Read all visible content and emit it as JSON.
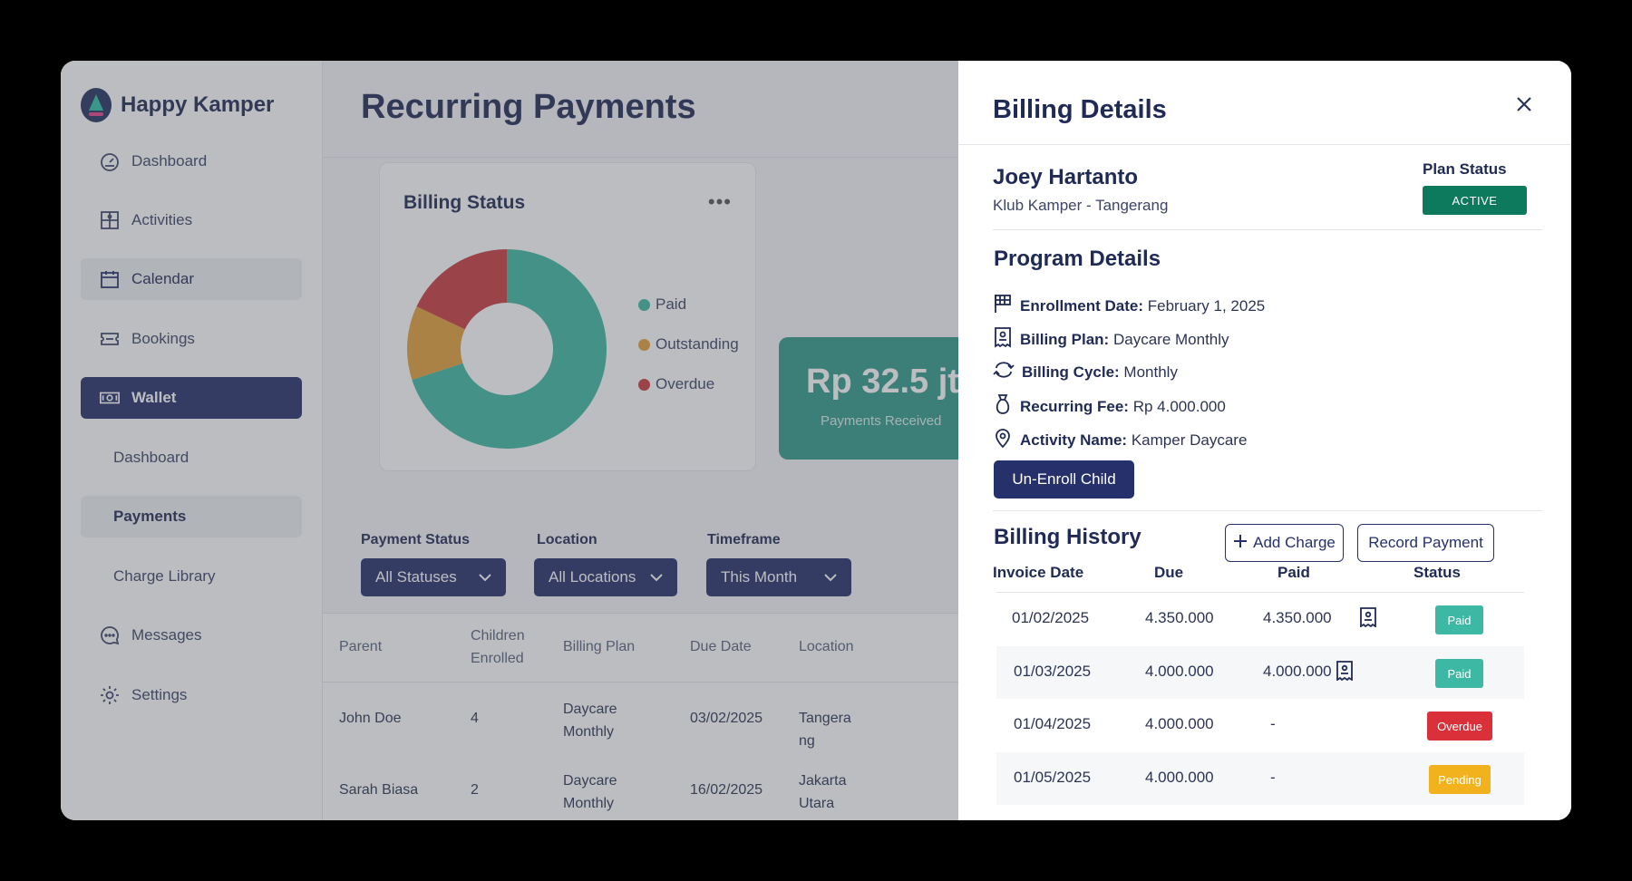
{
  "brand": {
    "name": "Happy Kamper"
  },
  "sidebar": {
    "items": [
      {
        "label": "Dashboard",
        "icon": "dashboard-gauge-icon"
      },
      {
        "label": "Activities",
        "icon": "activities-puzzle-icon"
      },
      {
        "label": "Calendar",
        "icon": "calendar-icon"
      },
      {
        "label": "Bookings",
        "icon": "ticket-icon"
      },
      {
        "label": "Wallet",
        "icon": "wallet-icon",
        "active": true
      },
      {
        "label": "Dashboard",
        "sub": true
      },
      {
        "label": "Payments",
        "sub": true,
        "active": true
      },
      {
        "label": "Charge Library",
        "sub": true
      },
      {
        "label": "Messages",
        "icon": "chat-bubble-icon"
      },
      {
        "label": "Settings",
        "icon": "gear-icon"
      }
    ]
  },
  "page": {
    "title": "Recurring Payments"
  },
  "billing_status": {
    "title": "Billing Status",
    "menu": "•••",
    "legend": [
      "Paid",
      "Outstanding",
      "Overdue"
    ]
  },
  "chart_data": {
    "type": "pie",
    "title": "Billing Status",
    "categories": [
      "Paid",
      "Outstanding",
      "Overdue"
    ],
    "values": [
      70,
      12,
      18
    ],
    "colors": [
      "#3cb8a4",
      "#e4a13a",
      "#c93a3f"
    ],
    "donut": true,
    "legend_position": "right"
  },
  "stat": {
    "value": "Rp 32.5 jt",
    "label": "Payments Received"
  },
  "filters": [
    {
      "label": "Payment Status",
      "value": "All Statuses"
    },
    {
      "label": "Location",
      "value": "All Locations"
    },
    {
      "label": "Timeframe",
      "value": "This Month"
    }
  ],
  "table": {
    "headers": [
      "Parent",
      "Children Enrolled",
      "Billing Plan",
      "Due Date",
      "Location"
    ],
    "rows": [
      {
        "parent": "John Doe",
        "children": "4",
        "plan": "Daycare Monthly",
        "due": "03/02/2025",
        "location": "Tangerang"
      },
      {
        "parent": "Sarah Biasa",
        "children": "2",
        "plan": "Daycare Monthly",
        "due": "16/02/2025",
        "location": "Jakarta Utara"
      }
    ]
  },
  "drawer": {
    "title": "Billing Details",
    "person": {
      "name": "Joey Hartanto",
      "location": "Klub Kamper - Tangerang"
    },
    "plan_status": {
      "label": "Plan Status",
      "value": "ACTIVE",
      "color": "#0d7a5e"
    },
    "program": {
      "title": "Program Details",
      "details": [
        {
          "label": "Enrollment Date:",
          "value": "February 1, 2025",
          "icon": "flag-grid-icon"
        },
        {
          "label": "Billing Plan:",
          "value": "Daycare Monthly",
          "icon": "receipt-icon"
        },
        {
          "label": "Billing Cycle:",
          "value": "Monthly",
          "icon": "cycle-arrows-icon"
        },
        {
          "label": "Recurring Fee:",
          "value": "Rp 4.000.000",
          "icon": "money-bag-icon"
        },
        {
          "label": "Activity Name:",
          "value": "Kamper Daycare",
          "icon": "location-pin-icon"
        }
      ],
      "unenroll_label": "Un-Enroll Child"
    },
    "history": {
      "title": "Billing History",
      "add_charge_label": "Add Charge",
      "record_payment_label": "Record Payment",
      "headers": [
        "Invoice Date",
        "Due",
        "Paid",
        "Status"
      ],
      "rows": [
        {
          "date": "01/02/2025",
          "due": "4.350.000",
          "paid": "4.350.000",
          "receipt": true,
          "status": "Paid",
          "color": "#3cb8a4"
        },
        {
          "date": "01/03/2025",
          "due": "4.000.000",
          "paid": "4.000.000",
          "receipt": true,
          "status": "Paid",
          "color": "#3cb8a4"
        },
        {
          "date": "01/04/2025",
          "due": "4.000.000",
          "paid": "-",
          "receipt": false,
          "status": "Overdue",
          "color": "#d9303a"
        },
        {
          "date": "01/05/2025",
          "due": "4.000.000",
          "paid": "-",
          "receipt": false,
          "status": "Pending",
          "color": "#f2b21e"
        }
      ]
    }
  }
}
